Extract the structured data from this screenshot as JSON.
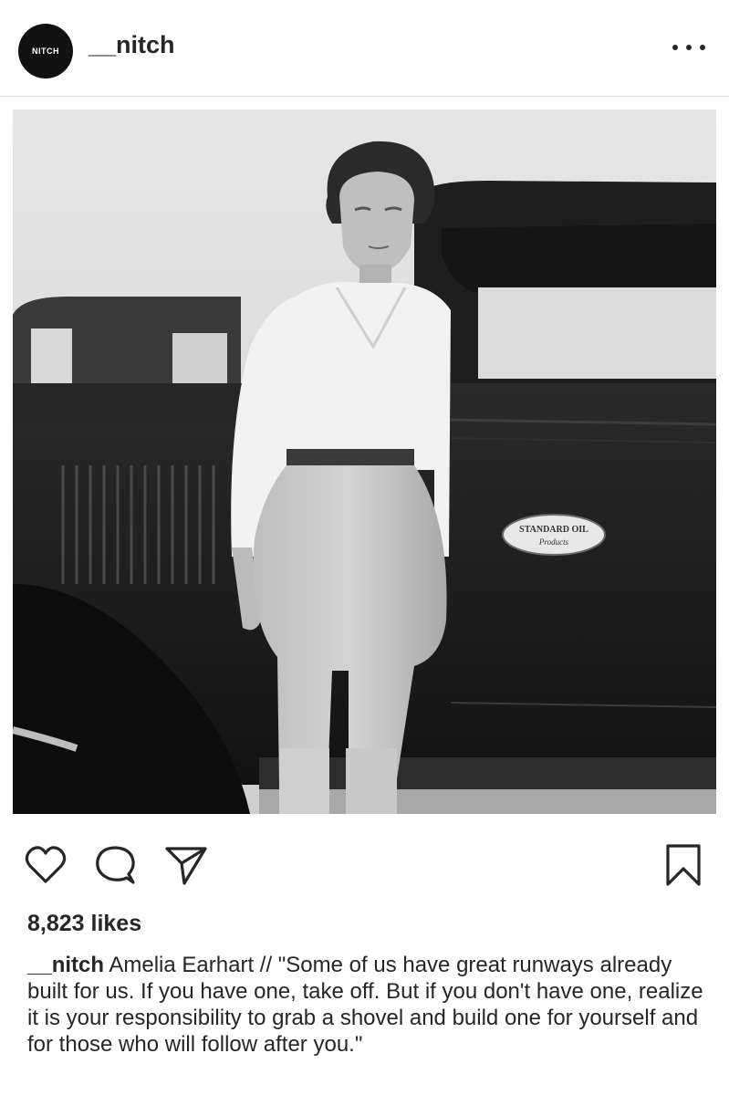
{
  "post": {
    "avatar_text": "NITCH",
    "username": "__nitch",
    "likes": "8,823 likes",
    "caption_user": "__nitch",
    "caption_text": "Amelia Earhart // \"Some of us have great runways already built for us. If you have one, take off. But if you don't have one, realize it is your responsibility to grab a shovel and build one for yourself and for those who will follow after you.\"",
    "photo_badge": "STANDARD OIL",
    "photo_badge_sub": "Products"
  },
  "icons": {
    "more": "more-options-icon",
    "like": "heart-icon",
    "comment": "comment-icon",
    "share": "paper-plane-icon",
    "save": "bookmark-icon"
  },
  "colors": {
    "text": "#262626",
    "avatar_bg": "#111111",
    "divider": "#e3e3e3"
  }
}
